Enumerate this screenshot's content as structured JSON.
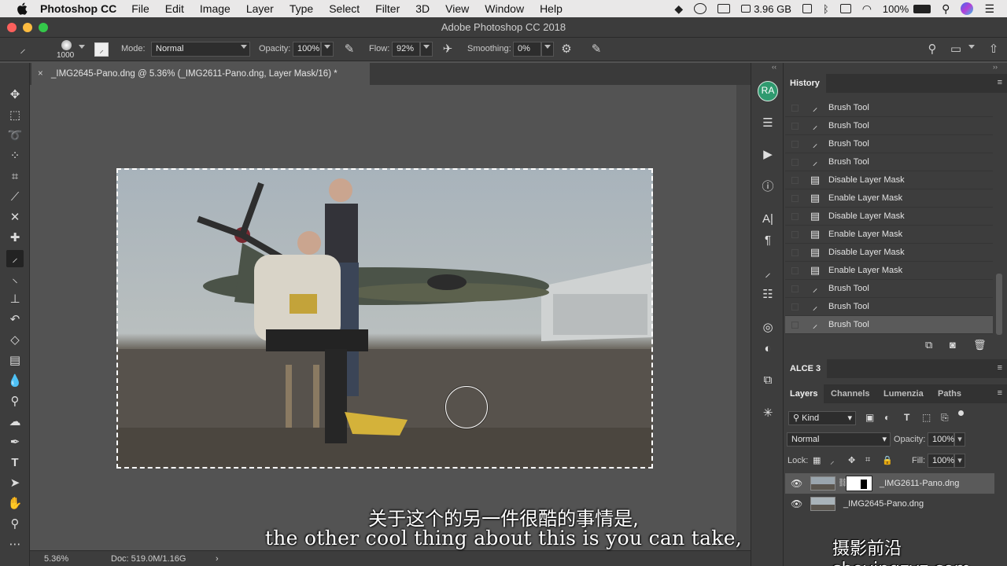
{
  "menubar": {
    "app": "Photoshop CC",
    "items": [
      "File",
      "Edit",
      "Image",
      "Layer",
      "Type",
      "Select",
      "Filter",
      "3D",
      "View",
      "Window",
      "Help"
    ],
    "memory": "3.96 GB",
    "battery": "100%"
  },
  "window": {
    "title": "Adobe Photoshop CC 2018"
  },
  "options": {
    "brush_size": "1000",
    "mode_label": "Mode:",
    "mode_value": "Normal",
    "opacity_label": "Opacity:",
    "opacity_value": "100%",
    "flow_label": "Flow:",
    "flow_value": "92%",
    "smoothing_label": "Smoothing:",
    "smoothing_value": "0%"
  },
  "document": {
    "tab_title": "_IMG2645-Pano.dng @ 5.36% (_IMG2611-Pano.dng, Layer Mask/16) *",
    "zoom": "5.36%",
    "doc_size": "Doc: 519.0M/1.16G"
  },
  "subtitles": {
    "chinese": "关于这个的另一件很酷的事情是,",
    "english": "the other cool thing about this is you can take,",
    "watermark": "摄影前沿sheyingzyz.com"
  },
  "dock": {
    "avatar": "RA"
  },
  "history": {
    "title": "History",
    "items": [
      {
        "label": "Brush Tool",
        "icon": "brush-icon"
      },
      {
        "label": "Brush Tool",
        "icon": "brush-icon"
      },
      {
        "label": "Brush Tool",
        "icon": "brush-icon"
      },
      {
        "label": "Brush Tool",
        "icon": "brush-icon"
      },
      {
        "label": "Disable Layer Mask",
        "icon": "document-icon"
      },
      {
        "label": "Enable Layer Mask",
        "icon": "document-icon"
      },
      {
        "label": "Disable Layer Mask",
        "icon": "document-icon"
      },
      {
        "label": "Enable Layer Mask",
        "icon": "document-icon"
      },
      {
        "label": "Disable Layer Mask",
        "icon": "document-icon"
      },
      {
        "label": "Enable Layer Mask",
        "icon": "document-icon"
      },
      {
        "label": "Brush Tool",
        "icon": "brush-icon"
      },
      {
        "label": "Brush Tool",
        "icon": "brush-icon"
      },
      {
        "label": "Brush Tool",
        "icon": "brush-icon"
      }
    ],
    "selected_index": 12
  },
  "alce": {
    "title": "ALCE 3"
  },
  "layers_panel": {
    "tabs": [
      "Layers",
      "Channels",
      "Lumenzia",
      "Paths"
    ],
    "kind_label": "Kind",
    "blend_mode": "Normal",
    "opacity_label": "Opacity:",
    "opacity_value": "100%",
    "lock_label": "Lock:",
    "fill_label": "Fill:",
    "fill_value": "100%",
    "layers": [
      {
        "name": "_IMG2611-Pano.dng",
        "has_mask": true,
        "selected": true
      },
      {
        "name": "_IMG2645-Pano.dng",
        "has_mask": false,
        "selected": false
      }
    ]
  },
  "colors": {
    "accent_green": "#2f9a6f",
    "panel_bg": "#3d3d3d",
    "canvas_bg": "#535353"
  }
}
